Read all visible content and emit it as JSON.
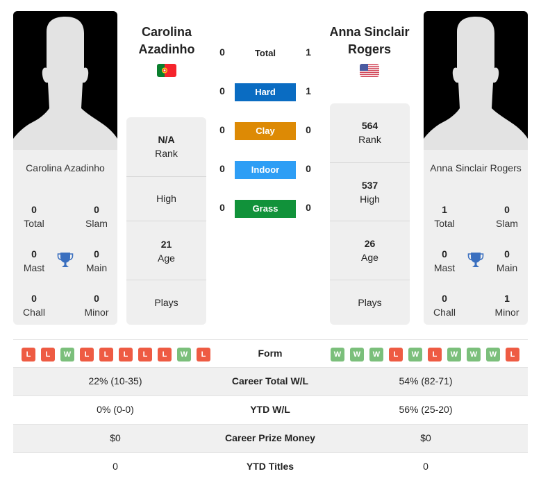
{
  "player1": {
    "name": "Carolina Azadinho",
    "name_line1": "Carolina",
    "name_line2": "Azadinho",
    "country_flag": "portugal-flag",
    "titles": {
      "total": {
        "value": "0",
        "label": "Total"
      },
      "slam": {
        "value": "0",
        "label": "Slam"
      },
      "mast": {
        "value": "0",
        "label": "Mast"
      },
      "main": {
        "value": "0",
        "label": "Main"
      },
      "chall": {
        "value": "0",
        "label": "Chall"
      },
      "minor": {
        "value": "0",
        "label": "Minor"
      }
    },
    "info": {
      "rank": {
        "value": "N/A",
        "label": "Rank"
      },
      "high": {
        "value": "",
        "label": "High"
      },
      "age": {
        "value": "21",
        "label": "Age"
      },
      "plays": {
        "value": "",
        "label": "Plays"
      }
    },
    "form": [
      "L",
      "L",
      "W",
      "L",
      "L",
      "L",
      "L",
      "L",
      "W",
      "L"
    ]
  },
  "player2": {
    "name": "Anna Sinclair Rogers",
    "name_line1": "Anna Sinclair",
    "name_line2": "Rogers",
    "country_flag": "usa-flag",
    "titles": {
      "total": {
        "value": "1",
        "label": "Total"
      },
      "slam": {
        "value": "0",
        "label": "Slam"
      },
      "mast": {
        "value": "0",
        "label": "Mast"
      },
      "main": {
        "value": "0",
        "label": "Main"
      },
      "chall": {
        "value": "0",
        "label": "Chall"
      },
      "minor": {
        "value": "1",
        "label": "Minor"
      }
    },
    "info": {
      "rank": {
        "value": "564",
        "label": "Rank"
      },
      "high": {
        "value": "537",
        "label": "High"
      },
      "age": {
        "value": "26",
        "label": "Age"
      },
      "plays": {
        "value": "",
        "label": "Plays"
      }
    },
    "form": [
      "W",
      "W",
      "W",
      "L",
      "W",
      "L",
      "W",
      "W",
      "W",
      "L"
    ]
  },
  "h2h": [
    {
      "label": "Total",
      "p1": "0",
      "p2": "1",
      "color": ""
    },
    {
      "label": "Hard",
      "p1": "0",
      "p2": "1",
      "color": "#0a6cc2"
    },
    {
      "label": "Clay",
      "p1": "0",
      "p2": "0",
      "color": "#dd8a05"
    },
    {
      "label": "Indoor",
      "p1": "0",
      "p2": "0",
      "color": "#2e9ef5"
    },
    {
      "label": "Grass",
      "p1": "0",
      "p2": "0",
      "color": "#11923a"
    }
  ],
  "form_label": "Form",
  "stats": [
    {
      "label": "Career Total W/L",
      "p1": "22% (10-35)",
      "p2": "54% (82-71)"
    },
    {
      "label": "YTD W/L",
      "p1": "0% (0-0)",
      "p2": "56% (25-20)"
    },
    {
      "label": "Career Prize Money",
      "p1": "$0",
      "p2": "$0"
    },
    {
      "label": "YTD Titles",
      "p1": "0",
      "p2": "0"
    }
  ],
  "colors": {
    "win": "#7bbf7b",
    "loss": "#ee5b43",
    "trophy": "#3a6fbf"
  }
}
